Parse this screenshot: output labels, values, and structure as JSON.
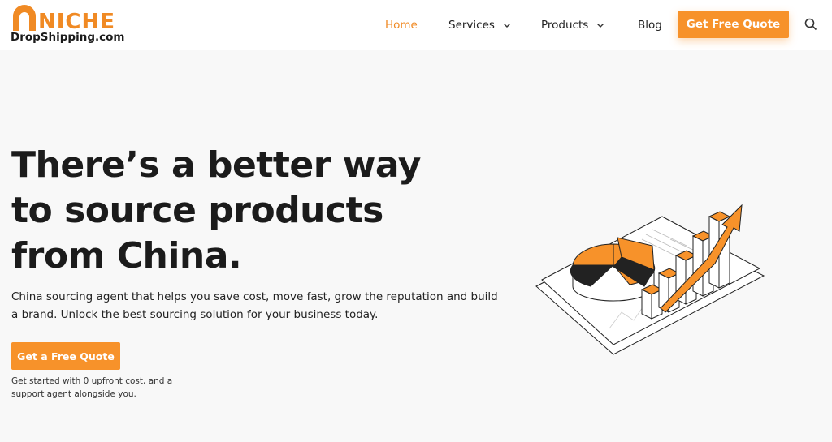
{
  "logo": {
    "brand": "NICHE",
    "domain": "DropShipping.com",
    "brand_color": "#f08a24"
  },
  "nav": {
    "items": [
      {
        "label": "Home",
        "active": true
      },
      {
        "label": "Services",
        "dropdown": true
      },
      {
        "label": "Products",
        "dropdown": true
      },
      {
        "label": "Blog"
      }
    ],
    "cta_label": "Get Free Quote",
    "search_icon": "search-icon"
  },
  "hero": {
    "title": "There’s a better way to source products from China.",
    "subtitle": "China sourcing agent that helps you save cost, move fast, grow the reputation and build a brand. Unlock the best sourcing solution for your business today.",
    "cta_label": "Get a Free Quote",
    "note": "Get started with 0 upfront cost, and a support agent alongside you."
  },
  "colors": {
    "accent": "#f7922a",
    "text": "#1b1b1b",
    "background": "#f8f8f8"
  },
  "illustration": "chart-growth-illustration"
}
